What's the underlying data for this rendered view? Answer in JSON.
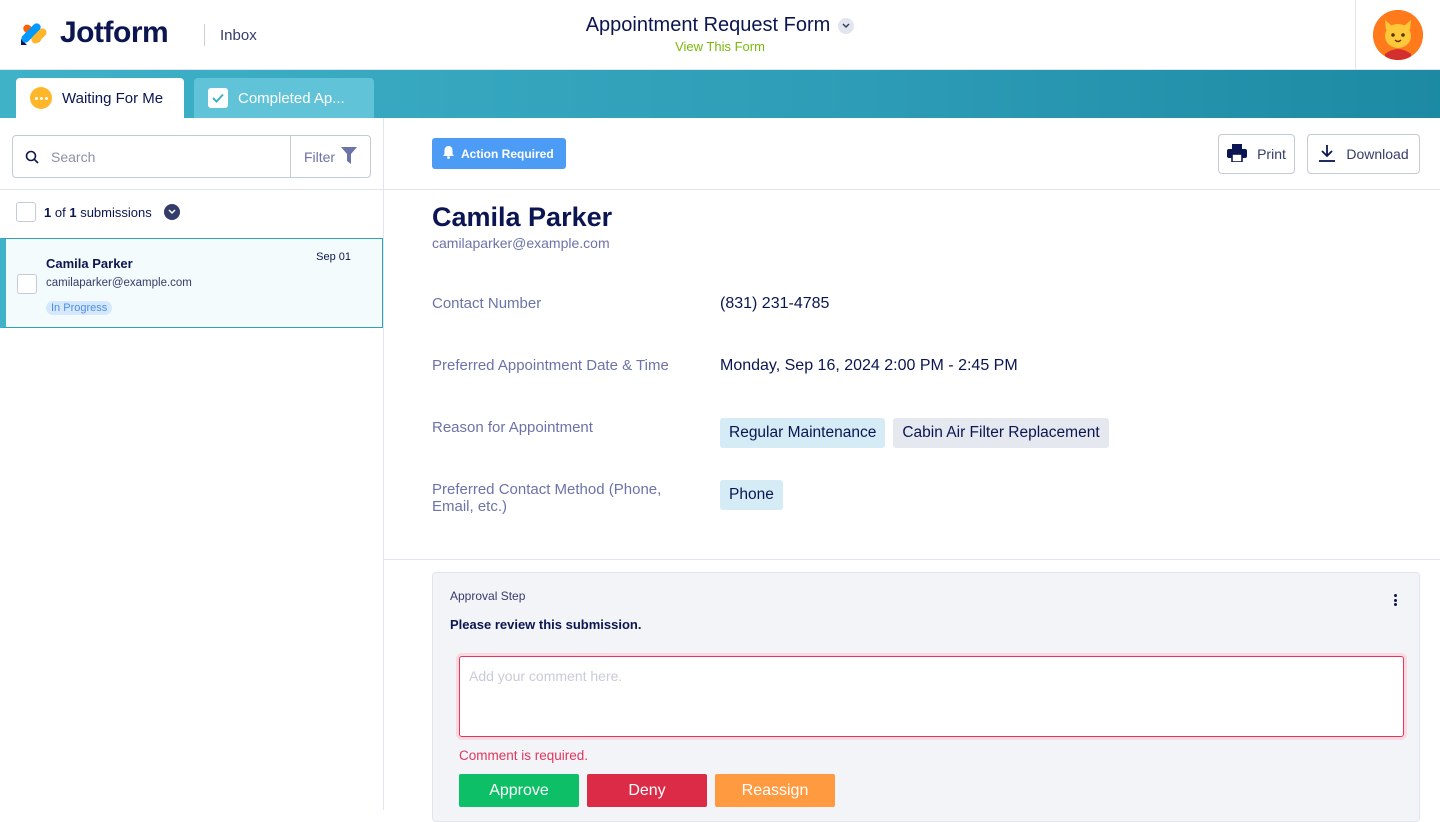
{
  "header": {
    "brand": "Jotform",
    "section": "Inbox",
    "form_title": "Appointment Request Form",
    "view_form_link": "View This Form"
  },
  "tabs": [
    {
      "label": "Waiting For Me",
      "icon": "dots-icon",
      "active": true
    },
    {
      "label": "Completed Ap...",
      "icon": "check-icon",
      "active": false
    }
  ],
  "sidebar": {
    "search_placeholder": "Search",
    "filter_label": "Filter",
    "count_current": "1",
    "count_of": "of",
    "count_total": "1",
    "count_suffix": "submissions",
    "submissions": [
      {
        "name": "Camila Parker",
        "email": "camilaparker@example.com",
        "date": "Sep 01",
        "status": "In Progress"
      }
    ]
  },
  "main": {
    "action_badge": "Action Required",
    "print_label": "Print",
    "download_label": "Download",
    "submitter_name": "Camila Parker",
    "submitter_email": "camilaparker@example.com",
    "fields": {
      "contact_number": {
        "label": "Contact Number",
        "value": "(831) 231-4785"
      },
      "preferred_datetime": {
        "label": "Preferred Appointment Date & Time",
        "value": "Monday, Sep 16, 2024 2:00 PM - 2:45 PM"
      },
      "reason": {
        "label": "Reason for Appointment",
        "chips": [
          "Regular Maintenance",
          "Cabin Air Filter Replacement"
        ]
      },
      "contact_method": {
        "label": "Preferred Contact Method (Phone, Email, etc.)",
        "chips": [
          "Phone"
        ]
      }
    },
    "approval": {
      "title": "Approval Step",
      "message": "Please review this submission.",
      "comment_placeholder": "Add your comment here.",
      "comment_value": "",
      "error": "Comment is required.",
      "approve_label": "Approve",
      "deny_label": "Deny",
      "reassign_label": "Reassign"
    }
  },
  "colors": {
    "brand_navy": "#0a1551",
    "tab_band": "#2d9cb6",
    "approve": "#0dbf66",
    "deny": "#dc2b47",
    "reassign": "#ff9a40",
    "action_badge": "#4c9cf5",
    "view_form_link": "#78bb07"
  }
}
